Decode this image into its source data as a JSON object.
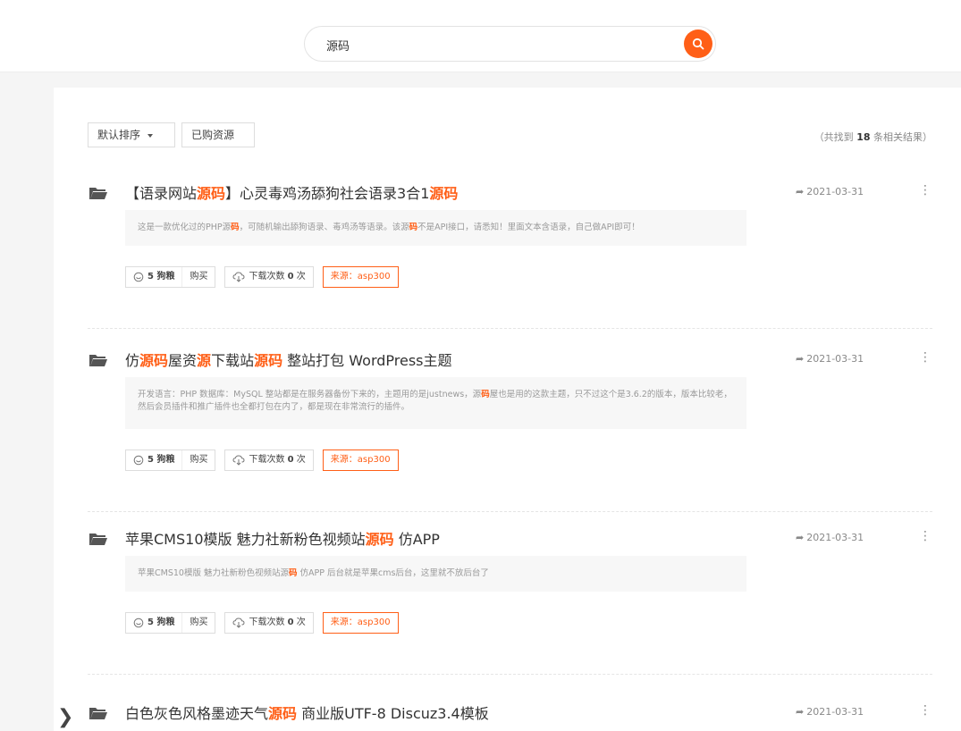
{
  "search": {
    "value": "源码"
  },
  "toolbar": {
    "sort_label": "默认排序",
    "purchased_label": "已购资源"
  },
  "result_count": {
    "prefix": "（共找到",
    "count": "18",
    "suffix": "条相关结果）"
  },
  "item_common": {
    "points": "5 狗粮",
    "buy": "购买",
    "download": "下载次数",
    "download_count": "0",
    "download_unit": "次",
    "source": "来源：asp300"
  },
  "items": [
    {
      "title": [
        {
          "t": "【语录网站",
          "h": false
        },
        {
          "t": "源码",
          "h": true
        },
        {
          "t": "】心灵毒鸡汤舔狗社会语录3合1",
          "h": false
        },
        {
          "t": "源码",
          "h": true
        }
      ],
      "desc": [
        {
          "t": "这是一款优化过的PHP源",
          "h": false
        },
        {
          "t": "码",
          "h": true
        },
        {
          "t": "，可随机输出舔狗语录、毒鸡汤等语录。该源",
          "h": false
        },
        {
          "t": "码",
          "h": true
        },
        {
          "t": "不是API接口，请悉知！里面文本含语录，自己做API即可！",
          "h": false
        }
      ],
      "date": "2021-03-31"
    },
    {
      "title": [
        {
          "t": "仿",
          "h": false
        },
        {
          "t": "源码",
          "h": true
        },
        {
          "t": "屋资",
          "h": false
        },
        {
          "t": "源",
          "h": true
        },
        {
          "t": "下载站",
          "h": false
        },
        {
          "t": "源码",
          "h": true
        },
        {
          "t": " 整站打包 WordPress主题",
          "h": false
        }
      ],
      "desc": [
        {
          "t": "开发语言：PHP 数据库：MySQL 整站都是在服务器备份下来的，主题用的是justnews，源",
          "h": false
        },
        {
          "t": "码",
          "h": true
        },
        {
          "t": "屋也是用的这款主题，只不过这个是3.6.2的版本，版本比较老，然后会员插件和推广插件也全都打包在内了，都是现在非常流行的插件。",
          "h": false
        }
      ],
      "date": "2021-03-31"
    },
    {
      "title": [
        {
          "t": "苹果CMS10模版 魅力社新粉色视频站",
          "h": false
        },
        {
          "t": "源码",
          "h": true
        },
        {
          "t": " 仿APP",
          "h": false
        }
      ],
      "desc": [
        {
          "t": "苹果CMS10模版 魅力社新粉色视频站源",
          "h": false
        },
        {
          "t": "码",
          "h": true
        },
        {
          "t": " 仿APP 后台就是苹果cms后台，这里就不放后台了",
          "h": false
        }
      ],
      "date": "2021-03-31"
    },
    {
      "title": [
        {
          "t": "白色灰色风格墨迹天气",
          "h": false
        },
        {
          "t": "源码",
          "h": true
        },
        {
          "t": " 商业版UTF-8 Discuz3.4模板",
          "h": false
        }
      ],
      "desc": [],
      "date": "2021-03-31"
    }
  ],
  "icons": {
    "search": "search-icon",
    "folder": "folder-icon",
    "share": "share-arrow-icon",
    "more": "more-vertical-icon",
    "coin": "coin-icon",
    "cloud": "cloud-download-icon",
    "nav": "chevron-left-icon"
  },
  "colors": {
    "accent": "#ff5f17"
  }
}
